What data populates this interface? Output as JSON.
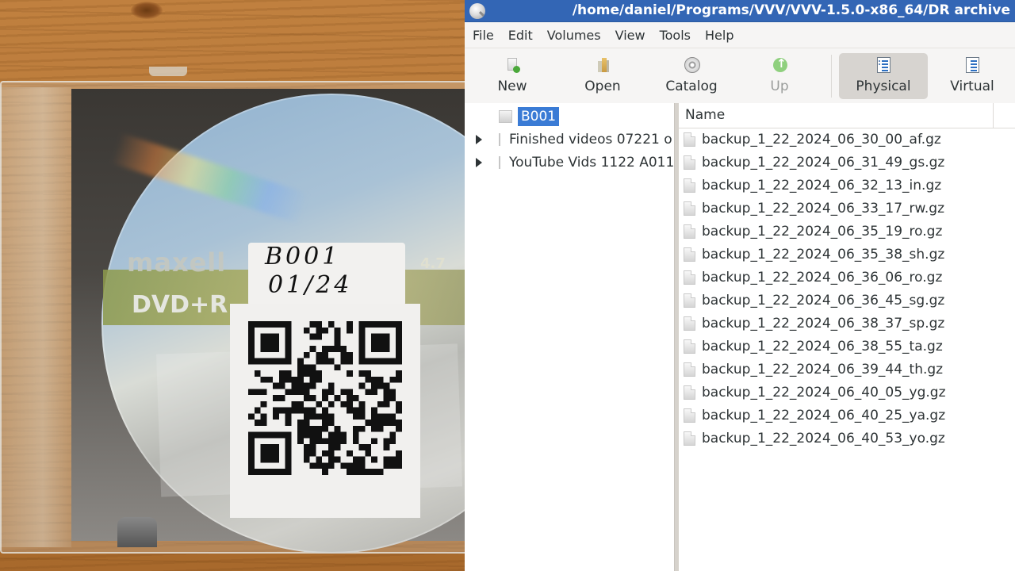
{
  "photo": {
    "description": "Photo of a DVD in a slim jewel case with a handwritten label and QR code",
    "disc_brand": "maxell",
    "disc_format": "DVD+R",
    "disc_capacity": "4.7",
    "label_line1": "B001",
    "label_line2": "01/24"
  },
  "window": {
    "title": "/home/daniel/Programs/VVV/VVV-1.5.0-x86_64/DR archive"
  },
  "menu": {
    "items": [
      "File",
      "Edit",
      "Volumes",
      "View",
      "Tools",
      "Help"
    ]
  },
  "toolbar": {
    "new": "New",
    "open": "Open",
    "catalog": "Catalog",
    "up": "Up",
    "physical": "Physical",
    "virtual": "Virtual",
    "active_view": "Physical"
  },
  "tree": {
    "items": [
      {
        "label": "B001",
        "selected": true,
        "expandable": false
      },
      {
        "label": "Finished videos 07221 o",
        "selected": false,
        "expandable": true
      },
      {
        "label": "YouTube Vids 1122 A011",
        "selected": false,
        "expandable": true
      }
    ]
  },
  "file_list": {
    "column_name": "Name",
    "files": [
      "backup_1_22_2024_06_30_00_af.gz",
      "backup_1_22_2024_06_31_49_gs.gz",
      "backup_1_22_2024_06_32_13_in.gz",
      "backup_1_22_2024_06_33_17_rw.gz",
      "backup_1_22_2024_06_35_19_ro.gz",
      "backup_1_22_2024_06_35_38_sh.gz",
      "backup_1_22_2024_06_36_06_ro.gz",
      "backup_1_22_2024_06_36_45_sg.gz",
      "backup_1_22_2024_06_38_37_sp.gz",
      "backup_1_22_2024_06_38_55_ta.gz",
      "backup_1_22_2024_06_39_44_th.gz",
      "backup_1_22_2024_06_40_05_yg.gz",
      "backup_1_22_2024_06_40_25_ya.gz",
      "backup_1_22_2024_06_40_53_yo.gz"
    ]
  },
  "colors": {
    "titlebar": "#3366b5",
    "selection": "#3a7bd5",
    "text": "#2e3436"
  }
}
